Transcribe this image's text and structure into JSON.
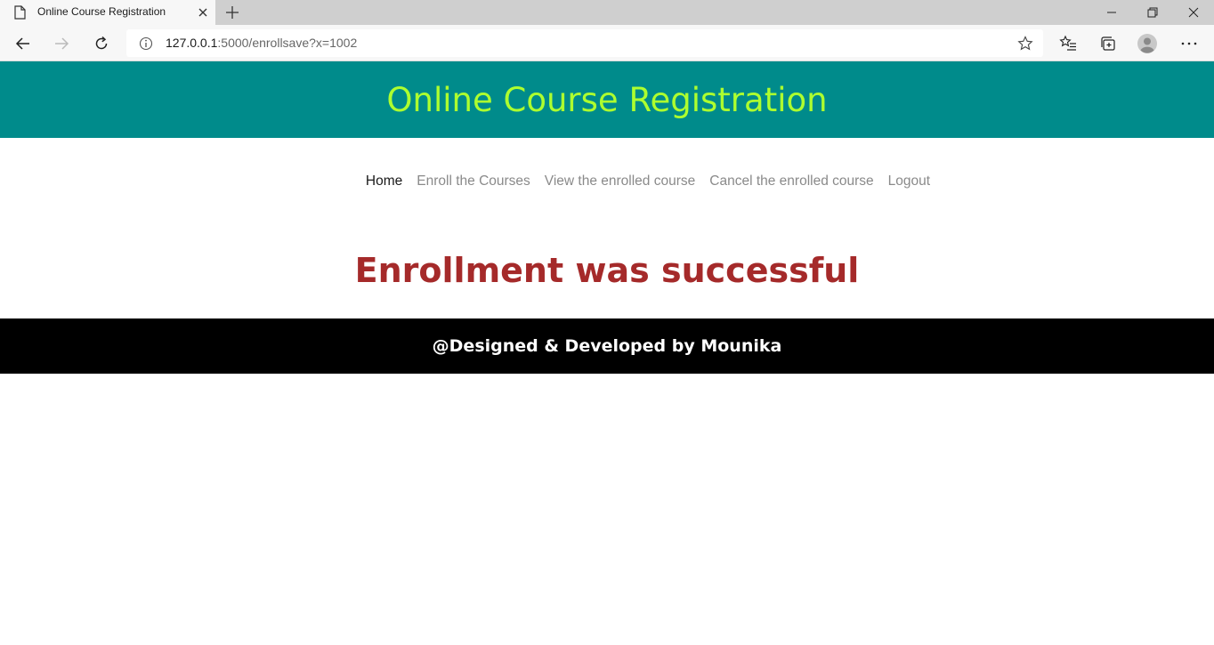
{
  "browser": {
    "tab_title": "Online Course Registration",
    "url_host": "127.0.0.1",
    "url_rest": ":5000/enrollsave?x=1002"
  },
  "header": {
    "title": "Online Course Registration",
    "title_color": "#adff2f",
    "background_color": "#008b8b"
  },
  "nav": {
    "items": [
      {
        "label": "Home",
        "active": true
      },
      {
        "label": "Enroll the Courses",
        "active": false
      },
      {
        "label": "View the enrolled course",
        "active": false
      },
      {
        "label": "Cancel the enrolled course",
        "active": false
      },
      {
        "label": "Logout",
        "active": false
      }
    ]
  },
  "main": {
    "message": "Enrollment was successful",
    "message_color": "#a52a2a"
  },
  "footer": {
    "text": "@Designed & Developed by Mounika",
    "background_color": "#000000"
  },
  "icons": [
    "page-icon",
    "close-icon",
    "plus-icon",
    "minimize-icon",
    "restore-icon",
    "window-close-icon",
    "back-icon",
    "forward-icon",
    "refresh-icon",
    "info-icon",
    "star-icon",
    "favorites-icon",
    "collections-icon",
    "profile-icon",
    "more-icon"
  ]
}
